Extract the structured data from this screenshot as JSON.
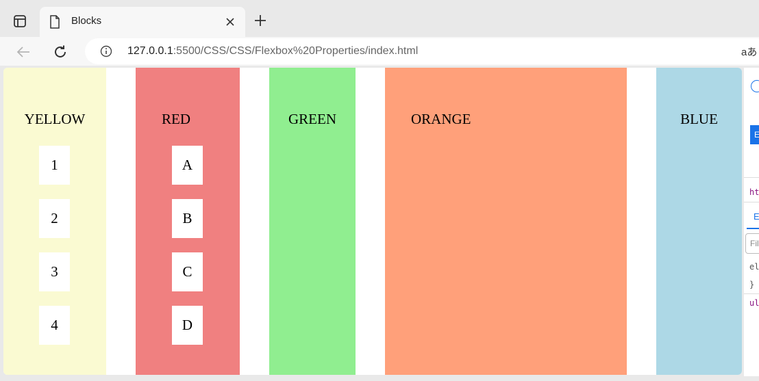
{
  "browser": {
    "tab_title": "Blocks",
    "url_host": "127.0.0.1",
    "url_path": ":5500/CSS/CSS/Flexbox%20Properties/index.html",
    "reader_glyph": "aあ"
  },
  "blocks": [
    {
      "label": "YELLOW",
      "color": "#fafad2",
      "items": [
        "1",
        "2",
        "3",
        "4"
      ]
    },
    {
      "label": "RED",
      "color": "#f08080",
      "items": [
        "A",
        "B",
        "C",
        "D"
      ]
    },
    {
      "label": "GREEN",
      "color": "#90ee90",
      "items": []
    },
    {
      "label": "ORANGE",
      "color": "#ffa07a",
      "items": []
    },
    {
      "label": "BLUE",
      "color": "#add8e6",
      "items": []
    }
  ],
  "devtools": {
    "btn": "E",
    "line1": "ht",
    "tab": "E",
    "filter": "Fil",
    "code1": "el",
    "code2": "}",
    "code3": "ul"
  },
  "icons": {
    "tab_actions": "tab-actions-icon",
    "page": "page-icon",
    "close": "close-icon",
    "new_tab": "plus-icon",
    "back": "back-arrow-icon",
    "reload": "reload-icon",
    "info": "info-icon"
  }
}
